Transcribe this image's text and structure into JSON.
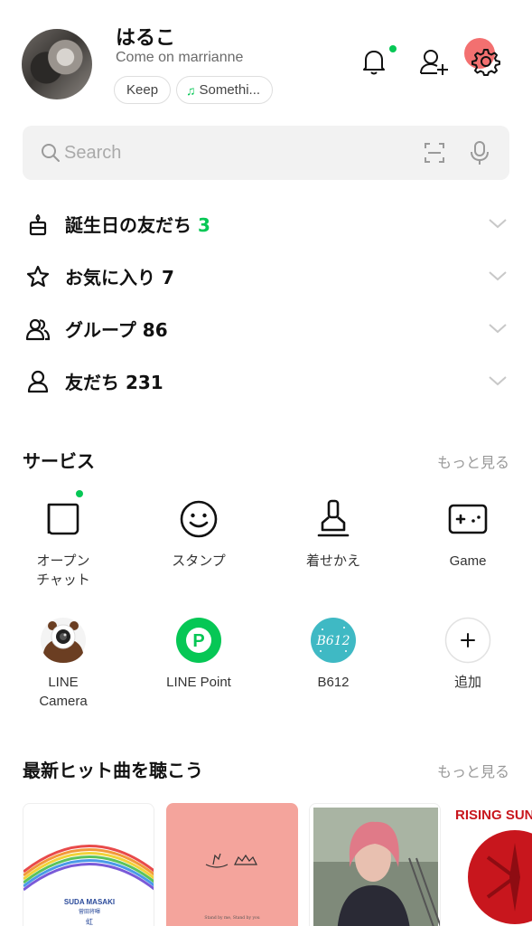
{
  "profile": {
    "name": "はるこ",
    "status": "Come on marrianne",
    "chips": {
      "keep": "Keep",
      "music": "Somethi..."
    }
  },
  "search": {
    "placeholder": "Search"
  },
  "friends": [
    {
      "icon": "birthday-cake-icon",
      "label": "誕生日の友だち",
      "count": "3",
      "count_color": "#06c755"
    },
    {
      "icon": "star-icon",
      "label": "お気に入り",
      "count": "7"
    },
    {
      "icon": "group-icon",
      "label": "グループ",
      "count": "86"
    },
    {
      "icon": "person-icon",
      "label": "友だち",
      "count": "231"
    }
  ],
  "services": {
    "title": "サービス",
    "more": "もっと見る",
    "items": [
      {
        "icon": "openchat-icon",
        "label": "オープン\nチャット"
      },
      {
        "icon": "sticker-icon",
        "label": "スタンプ"
      },
      {
        "icon": "theme-brush-icon",
        "label": "着せかえ"
      },
      {
        "icon": "game-controller-icon",
        "label": "Game"
      },
      {
        "icon": "line-camera-bear-icon",
        "label": "LINE\nCamera"
      },
      {
        "icon": "line-point-icon",
        "label": "LINE Point",
        "badge": "P"
      },
      {
        "icon": "b612-icon",
        "label": "B612",
        "badge": "B612"
      },
      {
        "icon": "add-icon",
        "label": "追加"
      }
    ]
  },
  "music": {
    "title": "最新ヒット曲を聴こう",
    "more": "もっと見る",
    "albums": [
      {
        "artist": "SUDA MASAKI",
        "sub": "菅田将暉",
        "title": "虹"
      },
      {
        "caption": "Stand by me, Stand by you"
      },
      {},
      {
        "title": "RISING SUN TO T"
      }
    ]
  },
  "colors": {
    "accent": "#06c755",
    "text": "#111111",
    "muted": "#999999"
  }
}
